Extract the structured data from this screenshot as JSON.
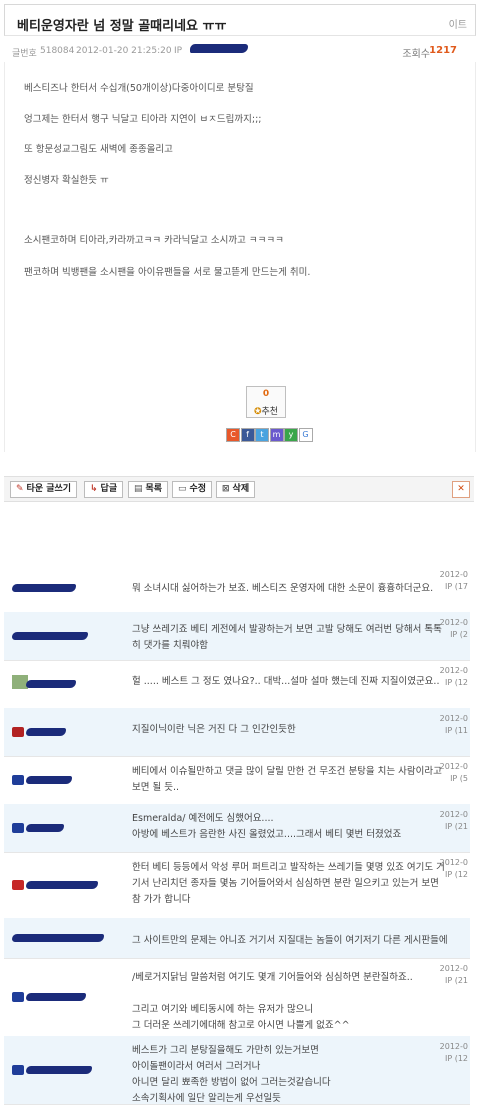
{
  "post": {
    "title": "베티운영자란 넘 정말 골때리네요 ㅠㅠ",
    "title_right": "이트",
    "number_label": "글번호",
    "number": "518084",
    "datetime": "2012-01-20 21:25:20",
    "ip_label": "IP",
    "views_label": "조회수",
    "views": "1217",
    "paragraphs": [
      "베스티즈나 한터서 수십개(50개이상)다중아이디로 분탕질",
      "엉그제는 한터서 행구 닉달고 티아라 지연이 ㅂㅈ드립까지;;;",
      "또 항문성교그림도 새벽에 종종올리고",
      "정신병자 확실한듯 ㅠ",
      "소시팬코하며 티아라,카라까고ㅋㅋ 카라닉달고 소시까고 ㅋㅋㅋㅋ",
      "팬코하며 빅뱅팬을 소시팬을 아이유팬들을 서로  물고뜯게 만드는게 취미."
    ],
    "recommend_count": "0",
    "recommend_label": "추천"
  },
  "share_icons": [
    {
      "name": "cyworld-icon",
      "glyph": "C",
      "color": "#e8582a"
    },
    {
      "name": "facebook-icon",
      "glyph": "f",
      "color": "#3b5998"
    },
    {
      "name": "twitter-icon",
      "glyph": "t",
      "color": "#4aa3df"
    },
    {
      "name": "me2day-icon",
      "glyph": "m",
      "color": "#6a5acd"
    },
    {
      "name": "yozm-icon",
      "glyph": "y",
      "color": "#3aa64a"
    },
    {
      "name": "google-icon",
      "glyph": "G",
      "color": "#ffffff"
    }
  ],
  "toolbar": {
    "new_post": "타운 글쓰기",
    "reply": "답글",
    "list": "목록",
    "edit": "수정",
    "delete": "삭제"
  },
  "comments": [
    {
      "text": "뭐 소녀시대 싫어하는가 보죠. 베스티즈 운영자에 대한 소문이 흉흉하더군요.",
      "date": "2012-0",
      "ip": "IP (17"
    },
    {
      "text": "그냥 쓰레기죠 베티 게전에서 발광하는거 보면 고발 당해도 여러번 당해서 톡톡히 댓가를 치뤄야함",
      "date": "2012-0",
      "ip": "IP (2"
    },
    {
      "text": "헐 ..... 베스트 그 정도 였나요?.. 대박...설마 설마 했는데 진짜 지질이였군요..",
      "date": "2012-0",
      "ip": "IP (12"
    },
    {
      "text": "지질이닉이란 닉은 거진 다 그 인간인듯한",
      "date": "2012-0",
      "ip": "IP (11"
    },
    {
      "text": "베티에서 이슈될만하고 댓글 많이 달릴 만한 건 무조건 분탕을 치는 사람이라고 보면 될 듯..",
      "date": "2012-0",
      "ip": "IP (5"
    },
    {
      "text": "Esmeralda/ 예전에도 심했어요....\n아방에 베스트가 음란한 사진 올렸었고....그래서 베티 몇번 터졌었죠",
      "date": "2012-0",
      "ip": "IP (21"
    },
    {
      "text": "한터 베티 등등에서 악성 루머 퍼트리고 발작하는 쓰레기들 몇명 있죠 여기도 거기서 난리치던 종자들 몇놈 기어들어와서 심심하면 분란 일으키고 있는거 보면 참 가가 합니다",
      "date": "2012-0",
      "ip": "IP (12"
    },
    {
      "text": "그 사이트만의 문제는 아니죠 거기서 지질대는 놈들이 여기저기 다른 게시판들에",
      "date": "",
      "ip": ""
    },
    {
      "text": "/베로거지닭님 말씀처럼 여기도 몇개 기어들어와 심심하면 분란질하죠..\n\n그리고 여기와 베티동시에 하는 유저가 많으니\n그 더러운 쓰레기에대해 참고로 아시면 나쁠게 없죠^^",
      "date": "2012-0",
      "ip": "IP (21"
    },
    {
      "text": "베스트가 그리 분탕질을해도 가만히 있는거보면\n아이돌팬이라서 여러서 그러거나\n아니면 달리 뾰족한 방법이 없어 그러는것같습니다\n소속기획사에 일단 알리는게 우선일듯",
      "date": "2012-0",
      "ip": "IP (12"
    }
  ]
}
